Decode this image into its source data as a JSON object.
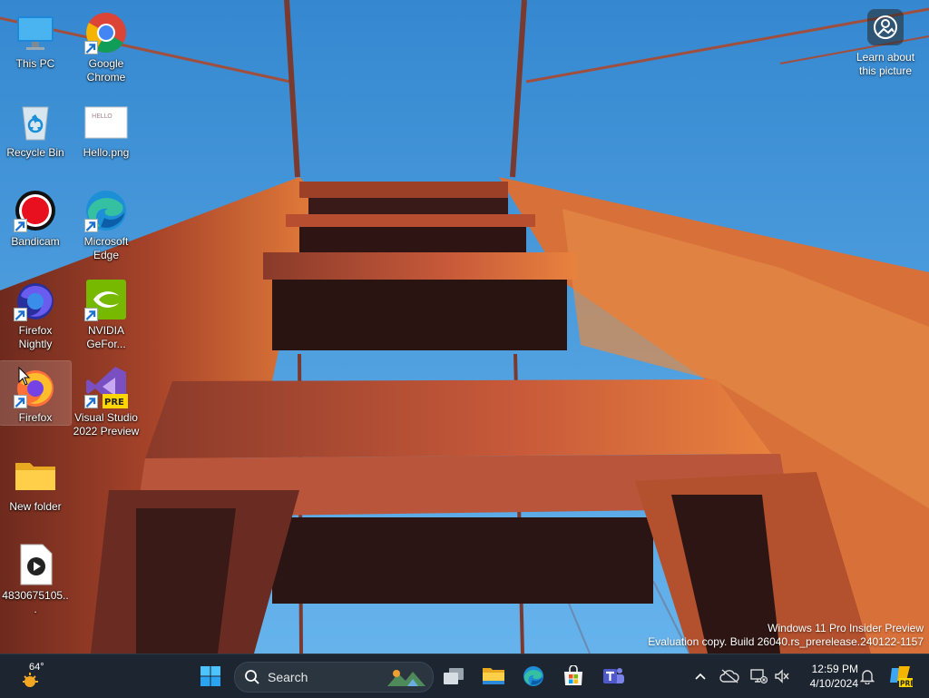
{
  "desktop": {
    "icons": [
      {
        "label": "This PC",
        "icon": "monitor-icon"
      },
      {
        "label": "Google Chrome",
        "icon": "chrome-icon"
      },
      {
        "label": "Recycle Bin",
        "icon": "recycle-bin-icon"
      },
      {
        "label": "Hello.png",
        "icon": "image-file-icon",
        "thumb_text": "HELLO"
      },
      {
        "label": "Bandicam",
        "icon": "bandicam-icon"
      },
      {
        "label": "Microsoft Edge",
        "icon": "edge-icon"
      },
      {
        "label": "Firefox Nightly",
        "icon": "firefox-nightly-icon"
      },
      {
        "label": "NVIDIA GeFor...",
        "icon": "nvidia-icon"
      },
      {
        "label": "Firefox",
        "icon": "firefox-icon"
      },
      {
        "label": "Visual Studio 2022 Preview",
        "icon": "visual-studio-icon",
        "badge": "PRE"
      },
      {
        "label": "New folder",
        "icon": "folder-icon"
      },
      {
        "label": "4830675105...",
        "icon": "video-file-icon"
      }
    ],
    "learn_about": "Learn about this picture"
  },
  "watermark": {
    "line1": "Windows 11 Pro Insider Preview",
    "line2": "Evaluation copy. Build 26040.rs_prerelease.240122-1157"
  },
  "taskbar": {
    "weather_temp": "64°",
    "search_placeholder": "Search",
    "apps": [
      "start-icon",
      "task-view-icon",
      "file-explorer-icon",
      "edge-icon",
      "microsoft-store-icon",
      "teams-icon"
    ],
    "copilot_badge": "PRE",
    "clock": {
      "time": "12:59 PM",
      "date": "4/10/2024"
    }
  },
  "colors": {
    "sky": "#3f8fd0",
    "bridge": "#c2502a",
    "taskbar": "#1d2630"
  }
}
